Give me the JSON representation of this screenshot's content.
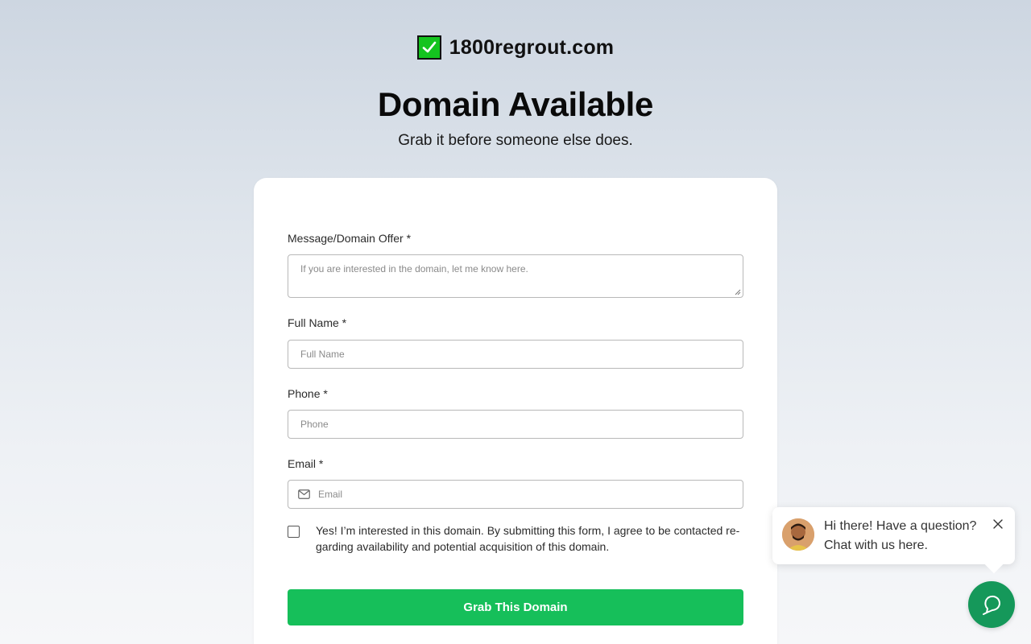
{
  "brand": {
    "domain": "1800regrout.com",
    "icon": "check-mark-icon"
  },
  "hero": {
    "headline": "Domain Available",
    "subline": "Grab it before someone else does."
  },
  "form": {
    "message": {
      "label": "Message/Domain Offer *",
      "placeholder": "If you are interested in the domain, let me know here."
    },
    "full_name": {
      "label": "Full Name *",
      "placeholder": "Full Name"
    },
    "phone": {
      "label": "Phone *",
      "placeholder": "Phone"
    },
    "email": {
      "label": "Email *",
      "placeholder": "Email",
      "icon": "envelope-icon"
    },
    "consent": {
      "checked": false,
      "text": "Yes! I’m interested in this domain. By submitting this form, I agree to be contacted re­garding availability and potential acquisition of this domain."
    },
    "submit_label": "Grab This Domain"
  },
  "chat": {
    "line1": "Hi there! Have a question?",
    "line2": "Chat with us here.",
    "close_icon": "close-icon",
    "launcher_icon": "chat-icon"
  },
  "colors": {
    "accent": "#16bf5a",
    "launcher": "#15985a",
    "check": "#14c41f"
  }
}
